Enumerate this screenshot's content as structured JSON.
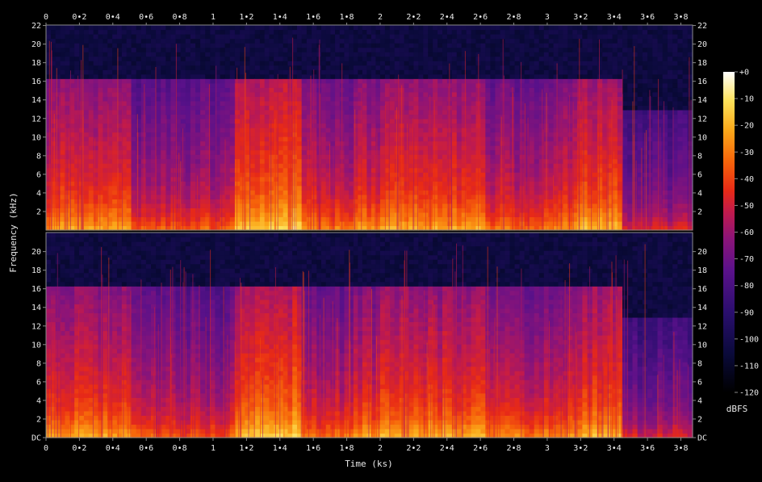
{
  "chart_data": {
    "type": "heatmap",
    "title": "",
    "xlabel": "Time (ks)",
    "ylabel": "Frequency (kHz)",
    "colorbar_label": "dBFS",
    "xlim": [
      0,
      3.87
    ],
    "ylim": [
      0,
      22.05
    ],
    "x_ticks": [
      "0",
      "0•2",
      "0•4",
      "0•6",
      "0•8",
      "1",
      "1•2",
      "1•4",
      "1•6",
      "1•8",
      "2",
      "2•2",
      "2•4",
      "2•6",
      "2•8",
      "3",
      "3•2",
      "3•4",
      "3•6",
      "3•8"
    ],
    "x_tick_values": [
      0,
      0.2,
      0.4,
      0.6,
      0.8,
      1.0,
      1.2,
      1.4,
      1.6,
      1.8,
      2.0,
      2.2,
      2.4,
      2.6,
      2.8,
      3.0,
      3.2,
      3.4,
      3.6,
      3.8
    ],
    "y_ticks_top": [
      "2",
      "4",
      "6",
      "8",
      "10",
      "12",
      "14",
      "16",
      "18",
      "20",
      "22"
    ],
    "y_ticks_bottom": [
      "DC",
      "2",
      "4",
      "6",
      "8",
      "10",
      "12",
      "14",
      "16",
      "18",
      "20"
    ],
    "y_tick_values_top": [
      2,
      4,
      6,
      8,
      10,
      12,
      14,
      16,
      18,
      20,
      22
    ],
    "y_tick_values_bottom": [
      0,
      2,
      4,
      6,
      8,
      10,
      12,
      14,
      16,
      18,
      20
    ],
    "colorbar_ticks": [
      "+0",
      "-10",
      "-20",
      "-30",
      "-40",
      "-50",
      "-60",
      "-70",
      "-80",
      "-90",
      "-100",
      "-110",
      "-120"
    ],
    "colorbar_range": [
      -120,
      0
    ],
    "channels": 2,
    "segments": [
      {
        "t0": 0.0,
        "t1": 0.51,
        "cutoff_khz": 16.5,
        "level_db": -48
      },
      {
        "t0": 0.51,
        "t1": 1.13,
        "cutoff_khz": 16.5,
        "level_db": -60
      },
      {
        "t0": 1.13,
        "t1": 1.28,
        "cutoff_khz": 16.5,
        "level_db": -42
      },
      {
        "t0": 1.28,
        "t1": 1.53,
        "cutoff_khz": 16.5,
        "level_db": -38
      },
      {
        "t0": 1.53,
        "t1": 1.62,
        "cutoff_khz": 16.5,
        "level_db": -52
      },
      {
        "t0": 1.62,
        "t1": 1.84,
        "cutoff_khz": 16.5,
        "level_db": -56
      },
      {
        "t0": 1.84,
        "t1": 2.0,
        "cutoff_khz": 16.5,
        "level_db": -50
      },
      {
        "t0": 2.0,
        "t1": 2.63,
        "cutoff_khz": 16.5,
        "level_db": -46
      },
      {
        "t0": 2.63,
        "t1": 2.98,
        "cutoff_khz": 16.5,
        "level_db": -55
      },
      {
        "t0": 2.98,
        "t1": 3.18,
        "cutoff_khz": 16.5,
        "level_db": -52
      },
      {
        "t0": 3.18,
        "t1": 3.45,
        "cutoff_khz": 16.5,
        "level_db": -44
      },
      {
        "t0": 3.45,
        "t1": 3.87,
        "cutoff_khz": 13.0,
        "level_db": -72
      }
    ],
    "colors": {
      "background": "#000000",
      "frame": "#8a8a8a"
    }
  }
}
